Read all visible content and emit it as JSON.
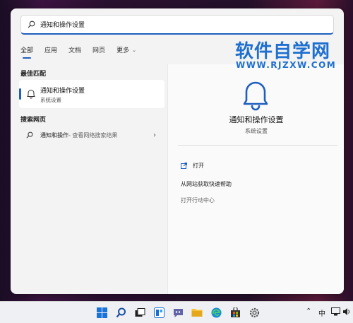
{
  "search": {
    "query": "通知和操作设置"
  },
  "tabs": [
    {
      "label": "全部"
    },
    {
      "label": "应用"
    },
    {
      "label": "文档"
    },
    {
      "label": "网页"
    },
    {
      "label": "更多"
    }
  ],
  "best_match": {
    "heading": "最佳匹配",
    "title": "通知和操作设置",
    "subtitle": "系统设置"
  },
  "web_search": {
    "heading": "搜索网页",
    "query": "通知和操作",
    "suffix": " - 查看网络搜索结果"
  },
  "detail": {
    "title": "通知和操作设置",
    "subtitle": "系统设置",
    "actions": [
      {
        "label": "打开"
      },
      {
        "label": "从网站获取快速帮助"
      },
      {
        "label": "打开行动中心"
      }
    ]
  },
  "watermark": {
    "title": "软件自学网",
    "url": "WWW.RJZXW.COM"
  },
  "tray": {
    "ime": "中"
  },
  "colors": {
    "accent": "#1f5fbf",
    "watermark": "#1e6fd0"
  }
}
